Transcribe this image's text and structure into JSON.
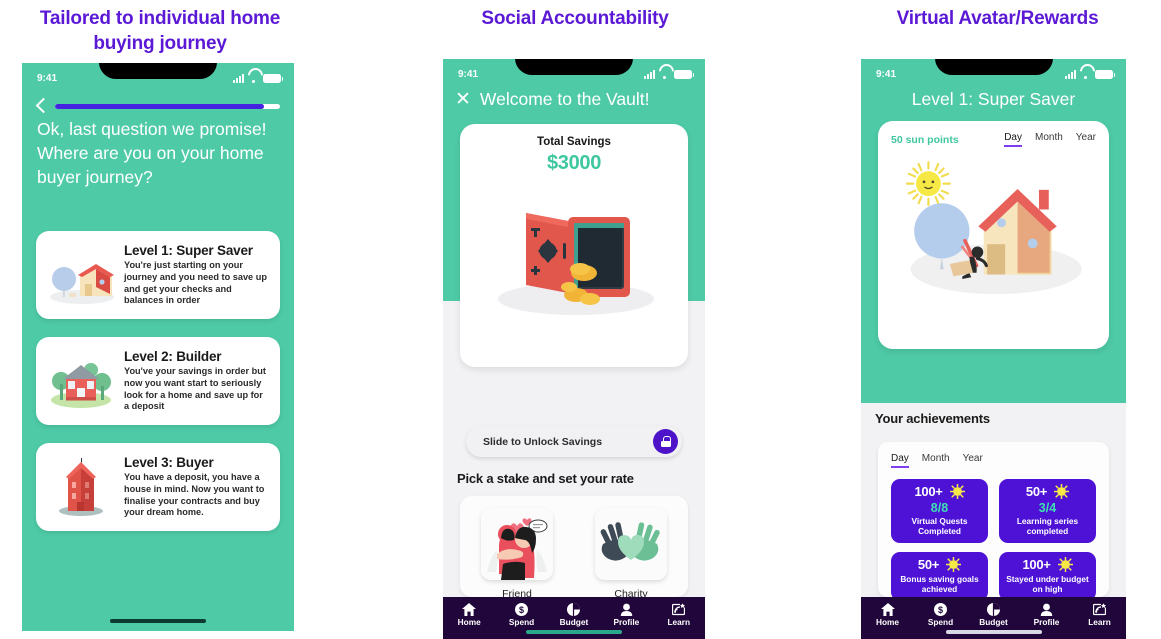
{
  "headings": [
    "Tailored to individual home buying journey",
    "Social Accountability",
    "Virtual Avatar/Rewards"
  ],
  "colors": {
    "heading_purple": "#5b19d6",
    "teal_bg": "#4ecaa6",
    "accent_green": "#3fc79f",
    "badge_purple": "#4d12d6",
    "nav_dark": "#20063a",
    "progress_purple": "#4522e0"
  },
  "status_bar": {
    "time": "9:41"
  },
  "phone1": {
    "progress_percent": 93,
    "back_label": "Back",
    "question": "Ok, last question we promise! Where are you on your home buyer journey?",
    "levels": [
      {
        "title": "Level 1: Super Saver",
        "description": "You're just starting on your journey and you need to save up and get your checks and balances in order",
        "art": "house-balloon-illustration"
      },
      {
        "title": "Level 2: Builder",
        "description": "You've your savings in order but now you want start to seriously look for a home and save up for a deposit",
        "art": "house-with-trees-illustration"
      },
      {
        "title": "Level 3: Buyer",
        "description": "You have a deposit, you have a house in mind. Now you want to finalise your contracts and buy your dream home.",
        "art": "tall-red-house-illustration"
      }
    ]
  },
  "phone2": {
    "header_title": "Welcome to the Vault!",
    "savings_label": "Total Savings",
    "savings_amount": "$3000",
    "vault_art": "open-safe-with-coins-illustration",
    "slide_label": "Slide to Unlock Savings",
    "stake_title": "Pick a stake and set your rate",
    "stakes": [
      {
        "caption": "Friend",
        "art": "two-people-hugging-illustration"
      },
      {
        "caption": "Charity",
        "art": "hands-holding-heart-illustration"
      }
    ]
  },
  "phone3": {
    "header_title": "Level 1: Super Saver",
    "sun_points": "50 sun points",
    "period_tabs": [
      {
        "label": "Day",
        "active": true
      },
      {
        "label": "Month",
        "active": false
      },
      {
        "label": "Year",
        "active": false
      }
    ],
    "avatar_art": "sun-house-person-with-balloon-illustration",
    "achievements_title": "Your achievements",
    "achv_tabs": [
      {
        "label": "Day",
        "active": true
      },
      {
        "label": "Month",
        "active": false
      },
      {
        "label": "Year",
        "active": false
      }
    ],
    "badges": [
      {
        "count": "100+",
        "score": "8/8",
        "label": "Virtual Quests Completed"
      },
      {
        "count": "50+",
        "score": "3/4",
        "label": "Learning series completed"
      },
      {
        "count": "50+",
        "score": "",
        "label": "Bonus saving goals achieved"
      },
      {
        "count": "100+",
        "score": "",
        "label": "Stayed under budget on high"
      }
    ]
  },
  "bottom_nav": [
    {
      "label": "Home",
      "icon": "home-icon"
    },
    {
      "label": "Spend",
      "icon": "dollar-coin-icon"
    },
    {
      "label": "Budget",
      "icon": "pie-chart-icon"
    },
    {
      "label": "Profile",
      "icon": "person-icon"
    },
    {
      "label": "Learn",
      "icon": "learn-card-icon"
    }
  ]
}
